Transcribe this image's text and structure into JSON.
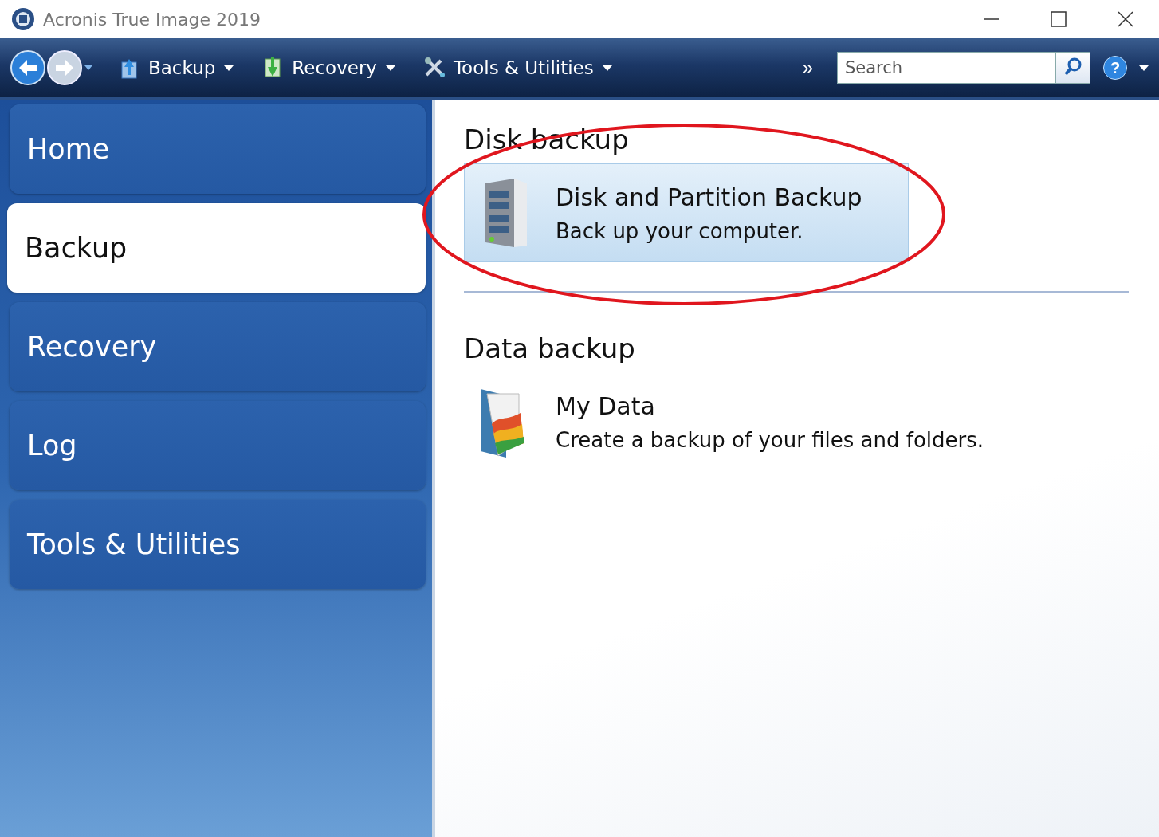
{
  "window": {
    "title": "Acronis True Image 2019"
  },
  "toolbar": {
    "menus": [
      {
        "label": "Backup",
        "kind": "backup"
      },
      {
        "label": "Recovery",
        "kind": "recovery"
      },
      {
        "label": "Tools & Utilities",
        "kind": "tools"
      }
    ],
    "overflow": "»",
    "search": {
      "placeholder": "Search"
    },
    "help": "?"
  },
  "sidebar": {
    "items": [
      {
        "label": "Home",
        "selected": false
      },
      {
        "label": "Backup",
        "selected": true
      },
      {
        "label": "Recovery",
        "selected": false
      },
      {
        "label": "Log",
        "selected": false
      },
      {
        "label": "Tools & Utilities",
        "selected": false
      }
    ]
  },
  "sections": [
    {
      "heading": "Disk backup",
      "items": [
        {
          "kind": "server",
          "title": "Disk and Partition Backup",
          "description": "Back up your computer.",
          "highlighted": true
        }
      ]
    },
    {
      "heading": "Data backup",
      "items": [
        {
          "kind": "folder",
          "title": "My Data",
          "description": "Create a backup of your files and folders.",
          "highlighted": false
        }
      ]
    }
  ],
  "annotation": {
    "kind": "ellipse"
  }
}
